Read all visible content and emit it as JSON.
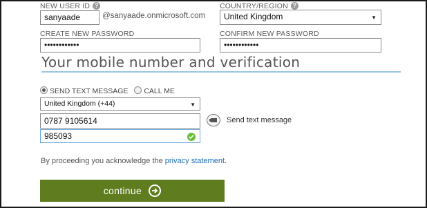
{
  "account": {
    "new_user_id_label": "NEW USER ID",
    "user_id_value": "sanyaade",
    "domain_suffix": "@sanyaade.onmicrosoft.com",
    "country_label": "COUNTRY/REGION",
    "country_value": "United Kingdom",
    "create_password_label": "CREATE NEW PASSWORD",
    "create_password_value": "••••••••••••",
    "confirm_password_label": "CONFIRM NEW PASSWORD",
    "confirm_password_value": "••••••••••••"
  },
  "mobile": {
    "section_title": "Your mobile number and verification",
    "option_text": "SEND TEXT MESSAGE",
    "option_call": "CALL ME",
    "selected_option": "text",
    "country_code_value": "United Kingdom (+44)",
    "phone_value": "0787 9105614",
    "send_text_label": "Send text message",
    "code_value": "985093"
  },
  "consent": {
    "prefix": "By proceeding you acknowledge the ",
    "link_text": "privacy statement",
    "suffix": "."
  },
  "continue_label": "continue",
  "colors": {
    "continue_bg": "#5f7d1f",
    "link": "#1e6fb8",
    "section_rule": "#9cc6e3",
    "ok_green": "#6abf3a"
  }
}
